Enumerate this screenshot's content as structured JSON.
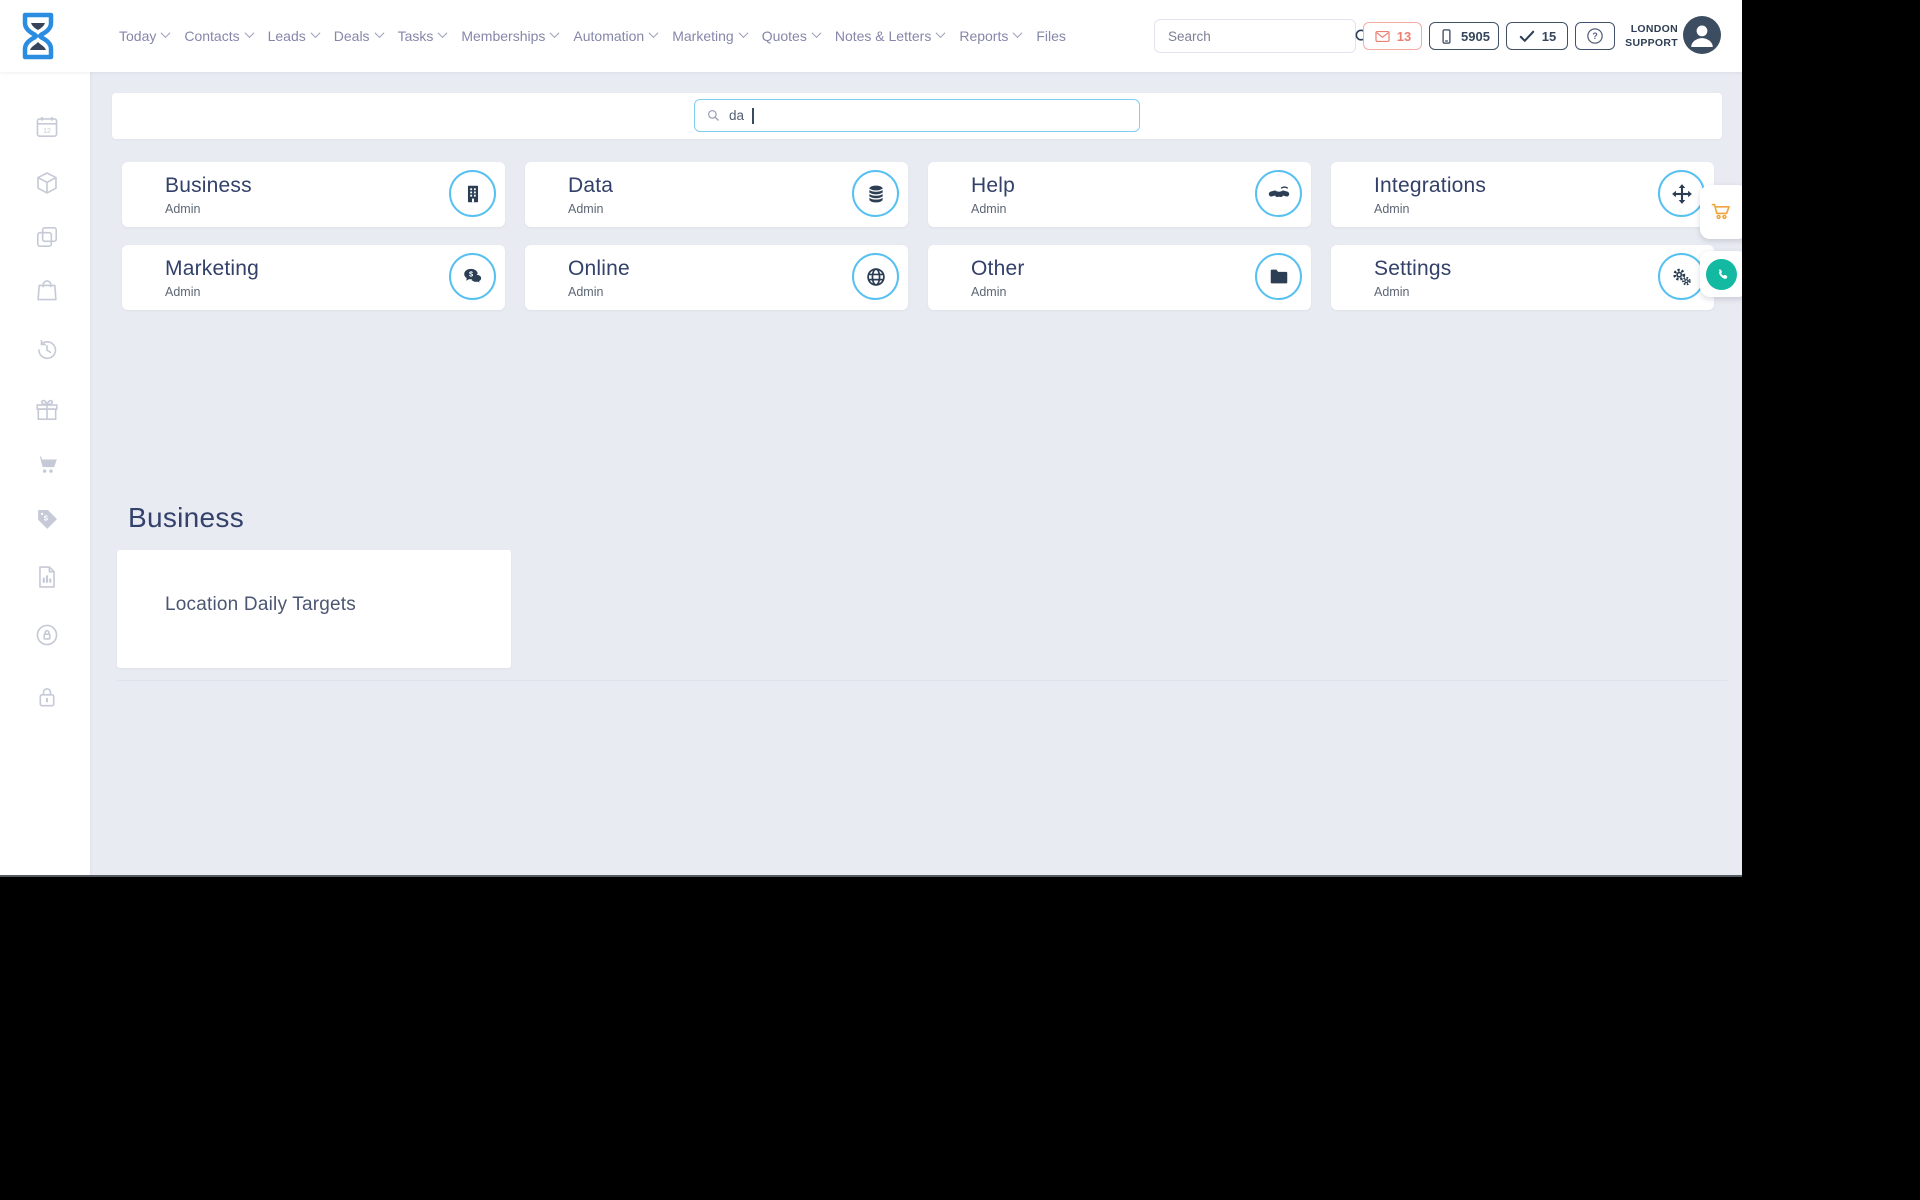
{
  "header": {
    "nav_items": [
      {
        "label": "Today"
      },
      {
        "label": "Contacts"
      },
      {
        "label": "Leads"
      },
      {
        "label": "Deals"
      },
      {
        "label": "Tasks"
      },
      {
        "label": "Memberships"
      },
      {
        "label": "Automation"
      },
      {
        "label": "Marketing"
      },
      {
        "label": "Quotes"
      },
      {
        "label": "Notes & Letters"
      },
      {
        "label": "Reports"
      },
      {
        "label": "Files"
      }
    ],
    "search": {
      "placeholder": "Search"
    },
    "badges": {
      "messages_count": "13",
      "phone_number": "5905",
      "tasks_count": "15"
    },
    "user": {
      "line1": "LONDON",
      "line2": "SUPPORT"
    }
  },
  "sidebar": {
    "icons": [
      "calendar",
      "product-cube",
      "duplicate",
      "shopping-bag",
      "history",
      "gift",
      "cart",
      "price-tag",
      "report",
      "session-lock",
      "padlock"
    ]
  },
  "admin": {
    "search_value": "da",
    "cards": [
      {
        "title": "Business",
        "subtitle": "Admin",
        "icon": "building-icon"
      },
      {
        "title": "Data",
        "subtitle": "Admin",
        "icon": "database-icon"
      },
      {
        "title": "Help",
        "subtitle": "Admin",
        "icon": "handshake-icon"
      },
      {
        "title": "Integrations",
        "subtitle": "Admin",
        "icon": "move-arrows-icon"
      },
      {
        "title": "Marketing",
        "subtitle": "Admin",
        "icon": "chat-dollar-icon"
      },
      {
        "title": "Online",
        "subtitle": "Admin",
        "icon": "globe-icon"
      },
      {
        "title": "Other",
        "subtitle": "Admin",
        "icon": "folder-icon"
      },
      {
        "title": "Settings",
        "subtitle": "Admin",
        "icon": "gears-icon"
      }
    ],
    "results": {
      "section": "Business",
      "items": [
        {
          "label": "Location Daily Targets"
        }
      ]
    }
  },
  "colors": {
    "accent_blue": "#56c0f0",
    "navy": "#2c3e54",
    "salmon": "#ed7f72",
    "orange": "#f0a43c",
    "teal": "#13b9a1",
    "logo_blue": "#2a8de2",
    "content_bg": "#e9ebf2"
  }
}
